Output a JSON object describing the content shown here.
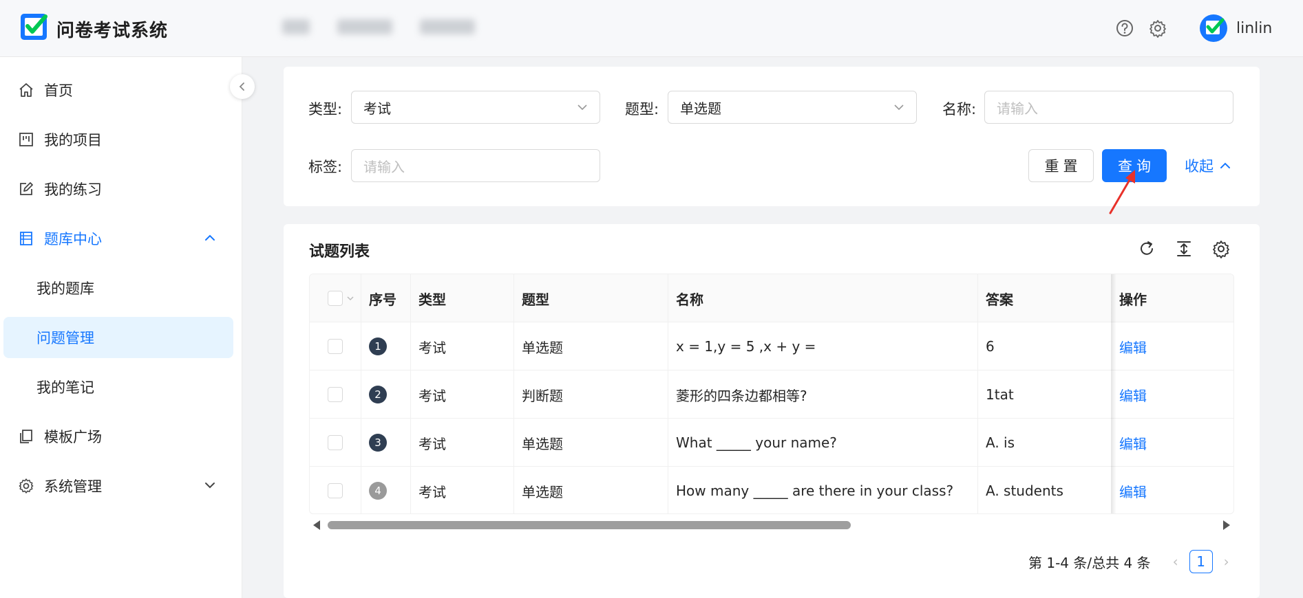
{
  "app": {
    "title": "问卷考试系统",
    "username": "linlin"
  },
  "sidebar": {
    "items": [
      {
        "label": "首页",
        "icon": "home-icon"
      },
      {
        "label": "我的项目",
        "icon": "project-icon"
      },
      {
        "label": "我的练习",
        "icon": "edit-icon"
      },
      {
        "label": "题库中心",
        "icon": "book-icon",
        "expanded": true
      },
      {
        "label": "我的题库"
      },
      {
        "label": "问题管理",
        "selected": true
      },
      {
        "label": "我的笔记"
      },
      {
        "label": "模板广场",
        "icon": "template-icon"
      },
      {
        "label": "系统管理",
        "icon": "gear-icon",
        "expanded": false
      }
    ]
  },
  "filters": {
    "type_label": "类型:",
    "type_value": "考试",
    "qtype_label": "题型:",
    "qtype_value": "单选题",
    "name_label": "名称:",
    "name_placeholder": "请输入",
    "tag_label": "标签:",
    "tag_placeholder": "请输入",
    "reset_label": "重置",
    "query_label": "查询",
    "collapse_label": "收起"
  },
  "table": {
    "title": "试题列表",
    "columns": [
      "序号",
      "类型",
      "题型",
      "名称",
      "答案",
      "操作"
    ],
    "rows": [
      {
        "index": "1",
        "type": "考试",
        "qtype": "单选题",
        "name": "x = 1,y = 5 ,x + y =",
        "answer": "6",
        "action": "编辑"
      },
      {
        "index": "2",
        "type": "考试",
        "qtype": "判断题",
        "name": "菱形的四条边都相等?",
        "answer": "1tat",
        "action": "编辑"
      },
      {
        "index": "3",
        "type": "考试",
        "qtype": "单选题",
        "name": "What _____ your name?",
        "answer": "A. is",
        "action": "编辑"
      },
      {
        "index": "4",
        "type": "考试",
        "qtype": "单选题",
        "name": "How many _____ are there in your class?",
        "answer": "A. students",
        "action": "编辑"
      }
    ]
  },
  "pagination": {
    "summary": "第 1-4 条/总共 4 条",
    "current_page": "1"
  },
  "colors": {
    "primary": "#1677ff",
    "selected_bg": "#e6f4ff",
    "badge": "#2f3e52",
    "logo_green": "#00c853"
  }
}
